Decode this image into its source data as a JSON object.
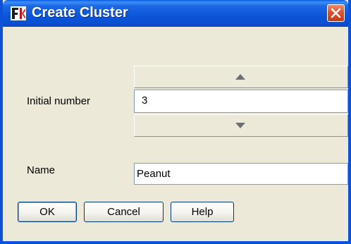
{
  "window": {
    "title": "Create Cluster",
    "icon": "app-icon",
    "close_icon": "close-icon"
  },
  "form": {
    "initial_number_label": "Initial number",
    "initial_number_value": "3",
    "increment_icon": "triangle-up-icon",
    "decrement_icon": "triangle-down-icon",
    "name_label": "Name",
    "name_value": "Peanut"
  },
  "buttons": {
    "ok": "OK",
    "cancel": "Cancel",
    "help": "Help"
  },
  "colors": {
    "titlebar": "#0a52d8",
    "dialog_bg": "#ece9d8",
    "close_button": "#e2502b",
    "input_border": "#7f9db9"
  }
}
